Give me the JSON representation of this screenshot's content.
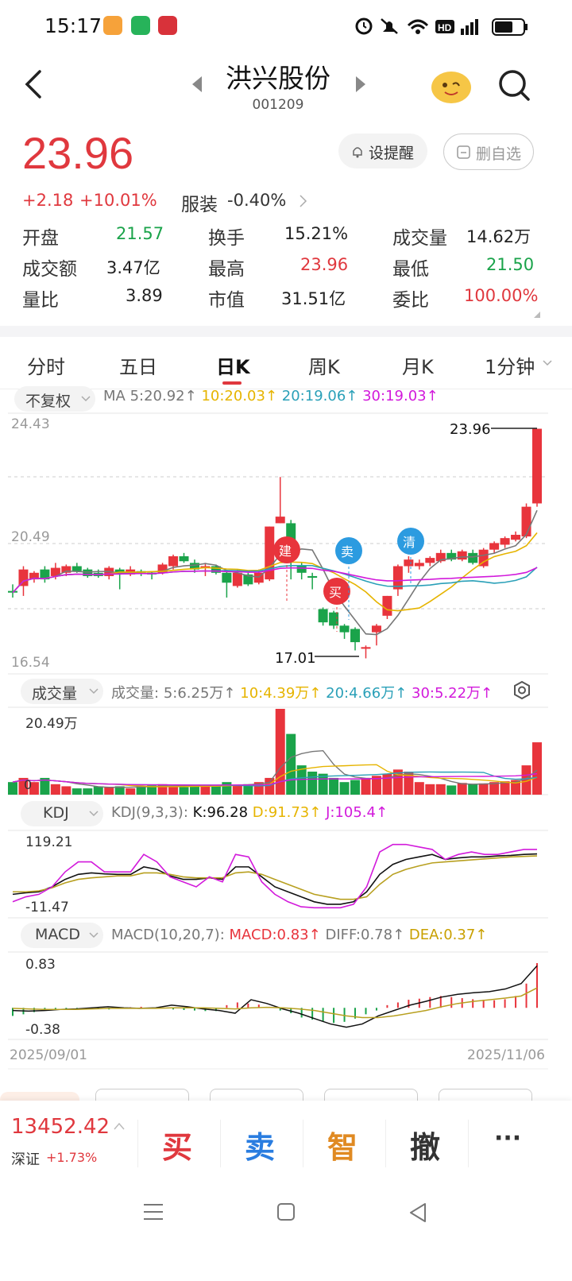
{
  "status": {
    "time": "15:17",
    "battery_level": 0.65
  },
  "header": {
    "title": "洪兴股份",
    "code": "001209"
  },
  "quote": {
    "price": "23.96",
    "change": "+2.18",
    "change_pct": "+10.01%",
    "sector": "服装",
    "sector_pct": "-0.40%",
    "remind_btn": "设提醒",
    "fav_btn": "删自选",
    "open_l": "开盘",
    "open_v": "21.57",
    "turn_l": "换手",
    "turn_v": "15.21%",
    "vol_l": "成交量",
    "vol_v": "14.62万",
    "amt_l": "成交额",
    "amt_v": "3.47亿",
    "high_l": "最高",
    "high_v": "23.96",
    "low_l": "最低",
    "low_v": "21.50",
    "qr_l": "量比",
    "qr_v": "3.89",
    "cap_l": "市值",
    "cap_v": "31.51亿",
    "wb_l": "委比",
    "wb_v": "100.00%"
  },
  "tabs": [
    "分时",
    "五日",
    "日K",
    "周K",
    "月K",
    "1分钟"
  ],
  "active_tab": 2,
  "chart_labels": {
    "adjust": "不复权",
    "ma_title": "MA",
    "ma5": "5:20.92",
    "ma10": "10:20.03",
    "ma20": "20:19.06",
    "ma30": "30:19.03",
    "y_top": "24.43",
    "y_mid": "20.49",
    "y_bot": "16.54",
    "max_label": "23.96",
    "min_label": "17.01",
    "sig_jian": "建",
    "sig_mai": "买",
    "sig_sell": "卖",
    "sig_clear": "清",
    "vol_sel": "成交量",
    "vol_title": "成交量:",
    "vol5": "5:6.25万",
    "vol10": "10:4.39万",
    "vol20": "20:4.66万",
    "vol30": "30:5.22万",
    "vol_max": "20.49万",
    "vol_zero": "0",
    "kdj_sel": "KDJ",
    "kdj_title": "KDJ(9,3,3):",
    "k": "K:96.28",
    "d": "D:91.73",
    "j": "J:105.4",
    "kdj_top": "119.21",
    "kdj_bot": "-11.47",
    "macd_sel": "MACD",
    "macd_title": "MACD(10,20,7):",
    "macd": "MACD:0.83",
    "diff": "DIFF:0.78",
    "dea": "DEA:0.37",
    "macd_top": "0.83",
    "macd_bot": "-0.38",
    "date_start": "2025/09/01",
    "date_end": "2025/11/06"
  },
  "colors": {
    "up": "#e8343c",
    "down": "#1aa34a",
    "ma5": "#777777",
    "ma10": "#e6b400",
    "ma20": "#2aa0b8",
    "ma30": "#d21adb",
    "blue_sig": "#2c9be0"
  },
  "bottom": {
    "index_val": "13452.42",
    "index_name": "深证",
    "index_pct": "+1.73%",
    "buy": "买",
    "sell": "卖",
    "smart": "智",
    "cancel": "撤",
    "more": "···"
  }
}
